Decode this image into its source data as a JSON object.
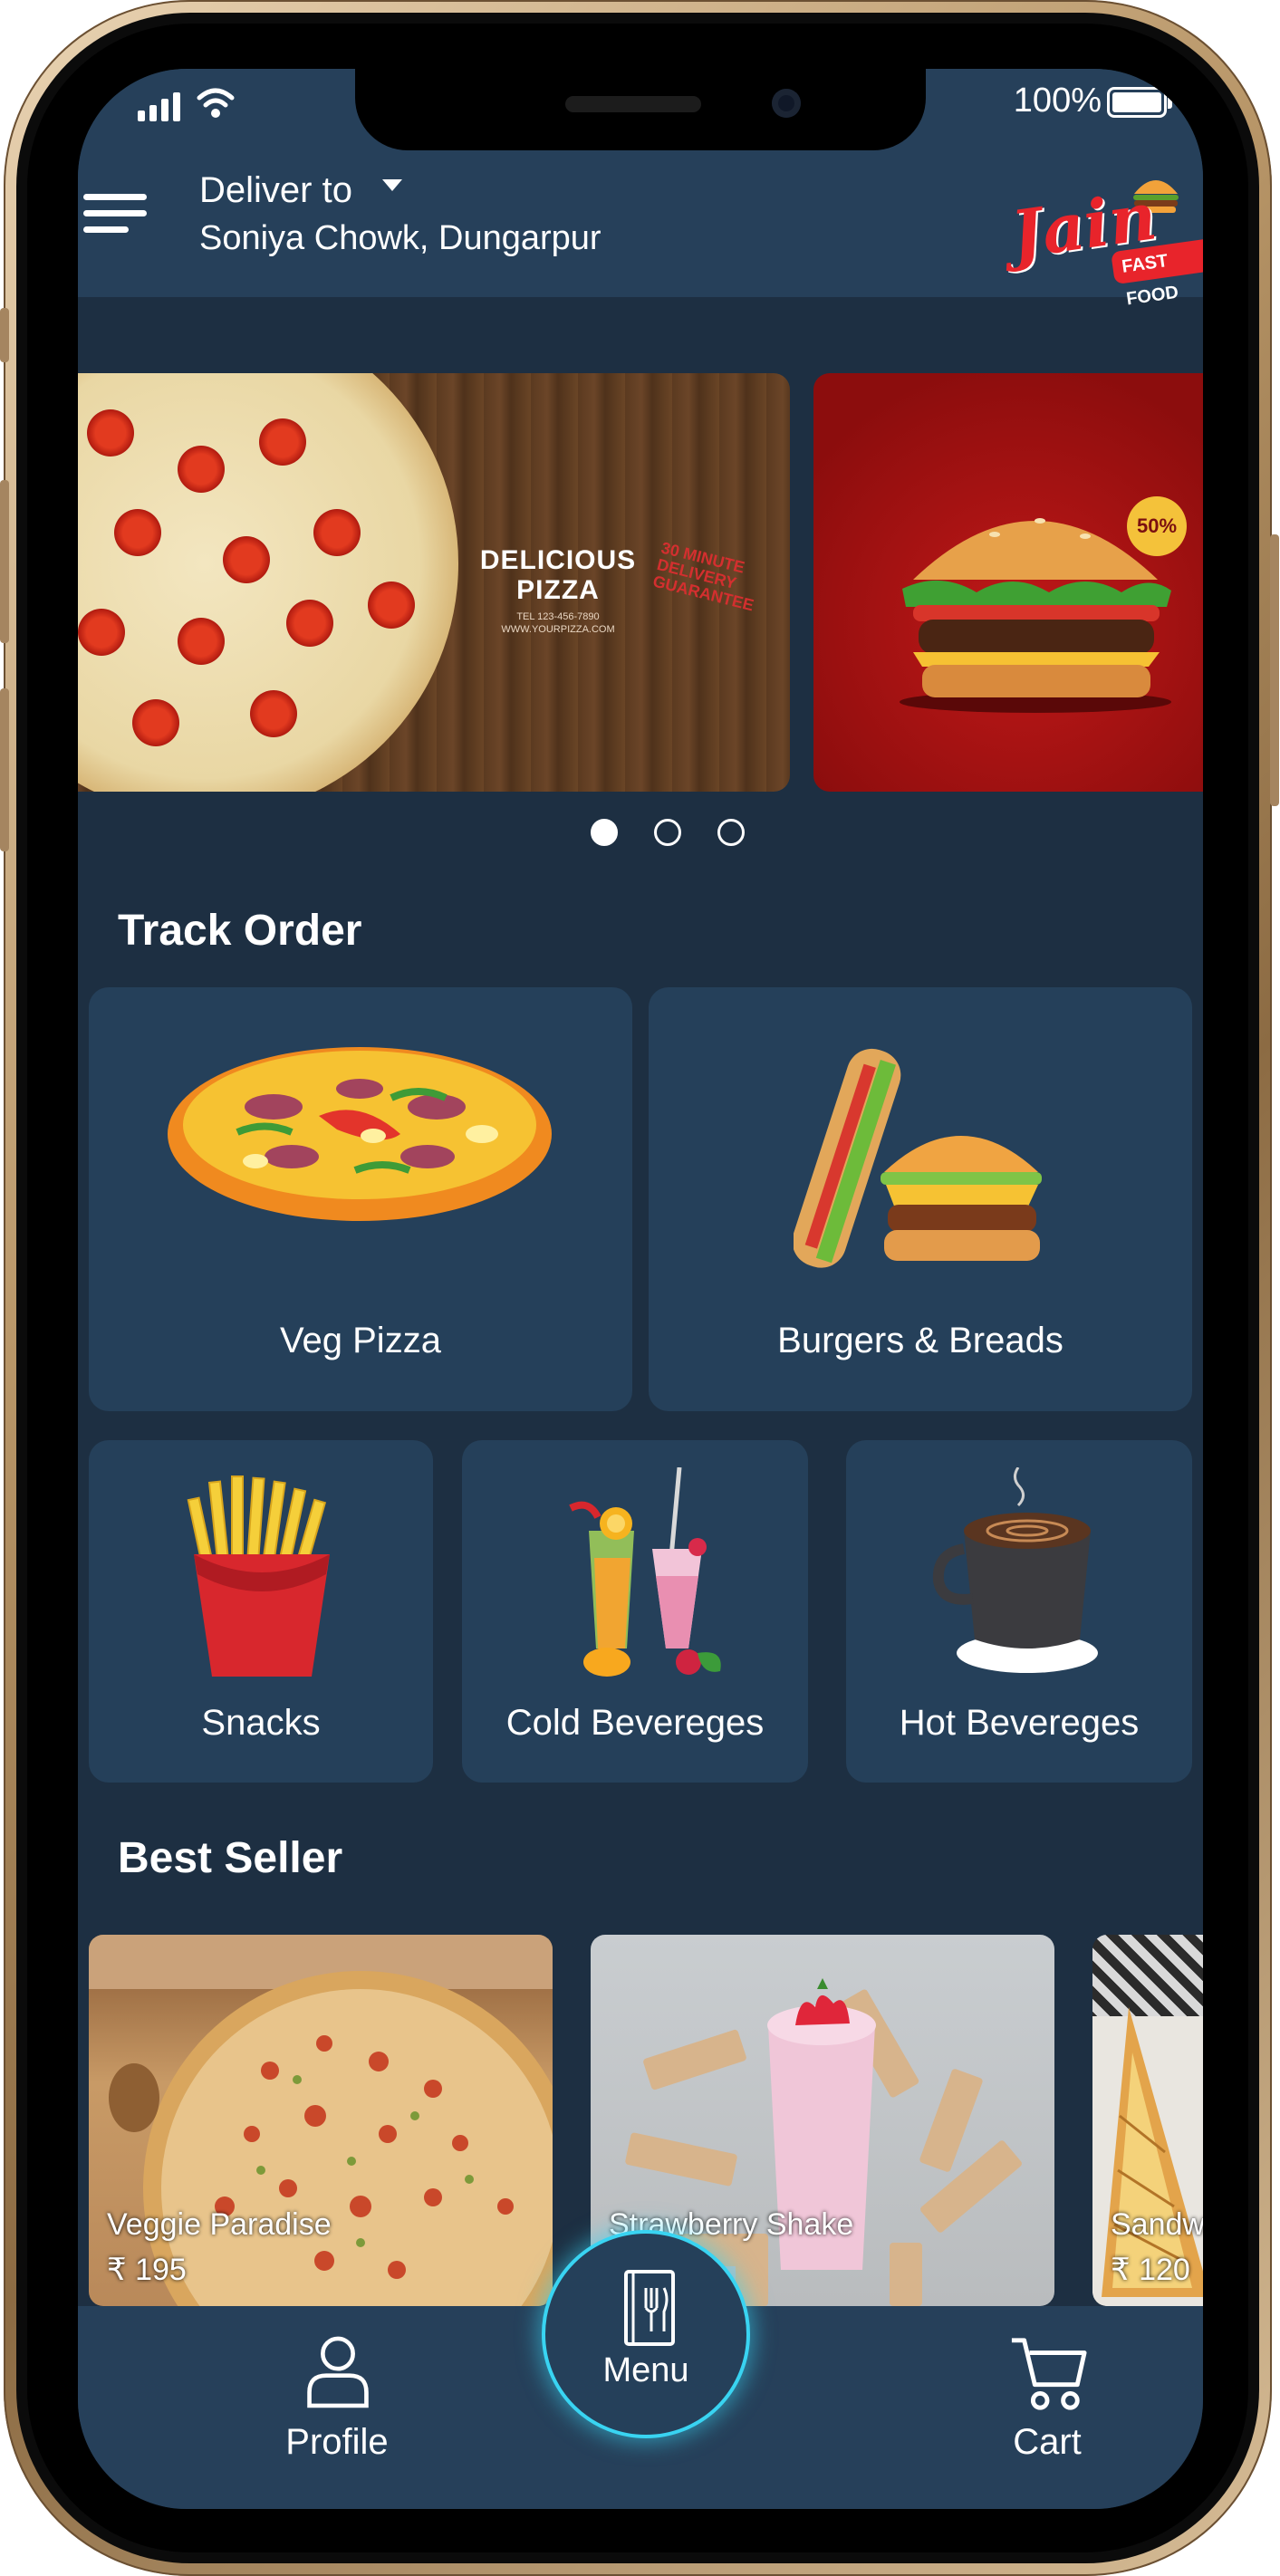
{
  "status_bar": {
    "battery_percent": "100%"
  },
  "header": {
    "deliver_label": "Deliver to",
    "address": "Soniya Chowk, Dungarpur",
    "logo_text": "Jain",
    "logo_subtext": "FAST FOOD"
  },
  "banners": [
    {
      "title": "DELICIOUS PIZZA",
      "contact_line": "TEL 123-456-7890",
      "url_line": "WWW.YOURPIZZA.COM",
      "badge": "30 MINUTE DELIVERY GUARANTEE"
    },
    {
      "badge": "50%"
    },
    {}
  ],
  "carousel": {
    "active_index": 0,
    "count": 3
  },
  "track_order": {
    "title": "Track Order",
    "categories": [
      {
        "label": "Veg Pizza",
        "icon": "pizza-icon"
      },
      {
        "label": "Burgers & Breads",
        "icon": "burger-icon"
      },
      {
        "label": "Snacks",
        "icon": "fries-icon"
      },
      {
        "label": "Cold Bevereges",
        "icon": "cold-drink-icon"
      },
      {
        "label": "Hot Bevereges",
        "icon": "coffee-icon"
      }
    ]
  },
  "best_seller": {
    "title": "Best Seller",
    "items": [
      {
        "name": "Veggie Paradise",
        "price": "₹ 195"
      },
      {
        "name": "Strawberry Shake",
        "price": ""
      },
      {
        "name": "Sandw",
        "price": "₹ 120"
      }
    ]
  },
  "bottom_nav": {
    "profile": "Profile",
    "menu": "Menu",
    "cart": "Cart"
  },
  "colors": {
    "background": "#1d2f42",
    "card": "#25405a",
    "accent_glow": "#39d4f2",
    "brand_red": "#e8242b"
  }
}
